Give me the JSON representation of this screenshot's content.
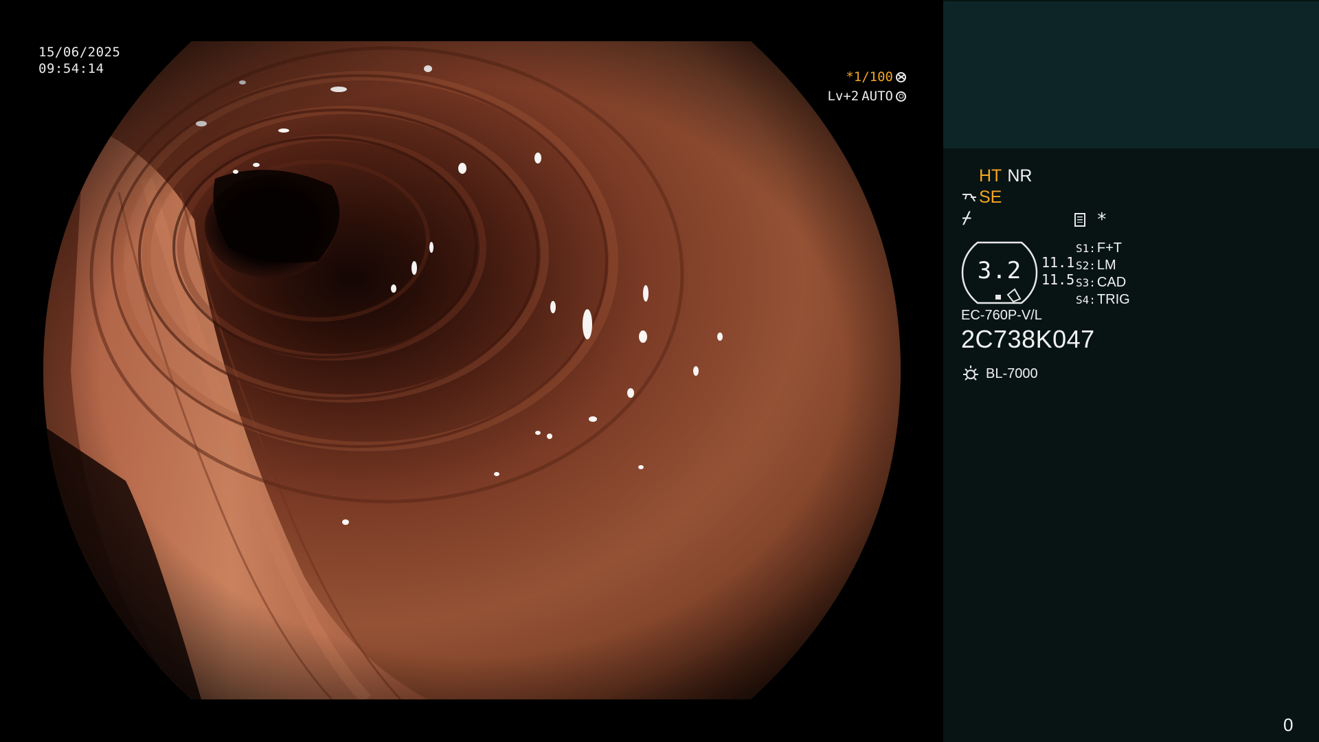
{
  "osd": {
    "date": "15/06/2025",
    "time": "09:54:14",
    "shutter_speed": "*1/100",
    "enhancement": "Lv+2",
    "iris_mode": "AUTO"
  },
  "panel": {
    "ht_label": "HT",
    "nr_label": "NR",
    "se_label": "SE",
    "structure_icon_glyph": "⌿",
    "asterisk": "*",
    "zoom_value": "3.2",
    "zoom_min": "11.1",
    "zoom_max": "11.5",
    "switches": [
      {
        "key": "S1:",
        "value": "F+T"
      },
      {
        "key": "S2:",
        "value": "LM"
      },
      {
        "key": "S3:",
        "value": "CAD"
      },
      {
        "key": "S4:",
        "value": "TRIG"
      }
    ],
    "scope_model": "EC-760P-V/L",
    "scope_serial": "2C738K047",
    "light_source": "BL-7000",
    "image_counter": "0"
  },
  "colors": {
    "osd_orange": "#f5a623",
    "panel_bg": "#081414",
    "thumbnail_bg": "#0e2528",
    "tissue_base": "#8a4a34"
  },
  "icons": {
    "shutter": "shutter-icon",
    "iris": "iris-icon",
    "fiber": "fiber-icon",
    "structure": "structure-icon",
    "memo": "memo-icon",
    "light": "light-bulb-icon"
  }
}
